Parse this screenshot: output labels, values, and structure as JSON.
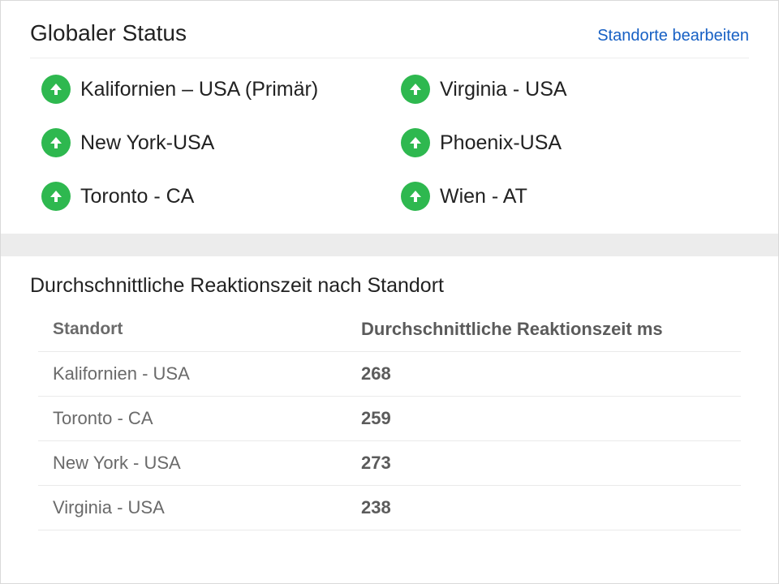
{
  "header": {
    "title": "Globaler Status",
    "edit_link": "Standorte bearbeiten"
  },
  "locations": [
    {
      "label": "Kalifornien – USA (Primär)"
    },
    {
      "label": "Virginia - USA"
    },
    {
      "label": "New York-USA"
    },
    {
      "label": "Phoenix-USA"
    },
    {
      "label": "Toronto - CA"
    },
    {
      "label": "Wien - AT"
    }
  ],
  "response_section": {
    "title": "Durchschnittliche Reaktionszeit nach Standort",
    "columns": {
      "location": "Standort",
      "avg_ms": "Durchschnittliche Reaktionszeit ms"
    },
    "rows": [
      {
        "location": "Kalifornien - USA",
        "avg_ms": "268"
      },
      {
        "location": "Toronto - CA",
        "avg_ms": "259"
      },
      {
        "location": "New York - USA",
        "avg_ms": "273"
      },
      {
        "location": "Virginia - USA",
        "avg_ms": "238"
      }
    ]
  }
}
